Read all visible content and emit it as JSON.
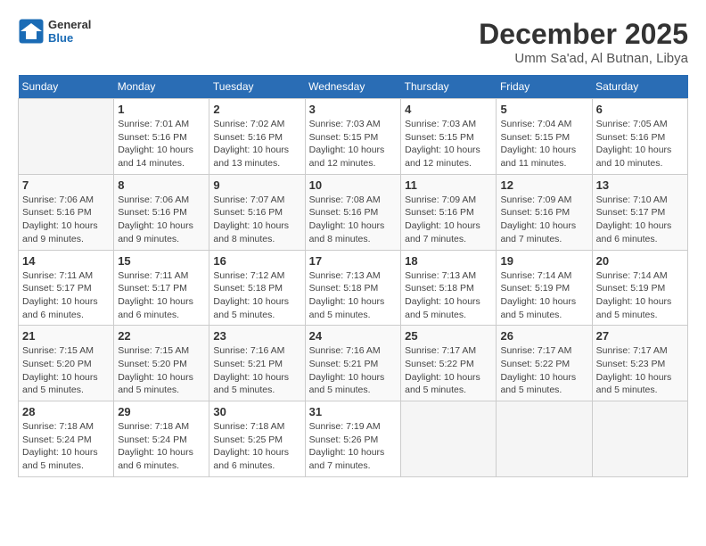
{
  "header": {
    "logo_general": "General",
    "logo_blue": "Blue",
    "title": "December 2025",
    "location": "Umm Sa'ad, Al Butnan, Libya"
  },
  "calendar": {
    "headers": [
      "Sunday",
      "Monday",
      "Tuesday",
      "Wednesday",
      "Thursday",
      "Friday",
      "Saturday"
    ],
    "weeks": [
      [
        {
          "day": "",
          "sunrise": "",
          "sunset": "",
          "daylight": ""
        },
        {
          "day": "1",
          "sunrise": "Sunrise: 7:01 AM",
          "sunset": "Sunset: 5:16 PM",
          "daylight": "Daylight: 10 hours and 14 minutes."
        },
        {
          "day": "2",
          "sunrise": "Sunrise: 7:02 AM",
          "sunset": "Sunset: 5:16 PM",
          "daylight": "Daylight: 10 hours and 13 minutes."
        },
        {
          "day": "3",
          "sunrise": "Sunrise: 7:03 AM",
          "sunset": "Sunset: 5:15 PM",
          "daylight": "Daylight: 10 hours and 12 minutes."
        },
        {
          "day": "4",
          "sunrise": "Sunrise: 7:03 AM",
          "sunset": "Sunset: 5:15 PM",
          "daylight": "Daylight: 10 hours and 12 minutes."
        },
        {
          "day": "5",
          "sunrise": "Sunrise: 7:04 AM",
          "sunset": "Sunset: 5:15 PM",
          "daylight": "Daylight: 10 hours and 11 minutes."
        },
        {
          "day": "6",
          "sunrise": "Sunrise: 7:05 AM",
          "sunset": "Sunset: 5:16 PM",
          "daylight": "Daylight: 10 hours and 10 minutes."
        }
      ],
      [
        {
          "day": "7",
          "sunrise": "Sunrise: 7:06 AM",
          "sunset": "Sunset: 5:16 PM",
          "daylight": "Daylight: 10 hours and 9 minutes."
        },
        {
          "day": "8",
          "sunrise": "Sunrise: 7:06 AM",
          "sunset": "Sunset: 5:16 PM",
          "daylight": "Daylight: 10 hours and 9 minutes."
        },
        {
          "day": "9",
          "sunrise": "Sunrise: 7:07 AM",
          "sunset": "Sunset: 5:16 PM",
          "daylight": "Daylight: 10 hours and 8 minutes."
        },
        {
          "day": "10",
          "sunrise": "Sunrise: 7:08 AM",
          "sunset": "Sunset: 5:16 PM",
          "daylight": "Daylight: 10 hours and 8 minutes."
        },
        {
          "day": "11",
          "sunrise": "Sunrise: 7:09 AM",
          "sunset": "Sunset: 5:16 PM",
          "daylight": "Daylight: 10 hours and 7 minutes."
        },
        {
          "day": "12",
          "sunrise": "Sunrise: 7:09 AM",
          "sunset": "Sunset: 5:16 PM",
          "daylight": "Daylight: 10 hours and 7 minutes."
        },
        {
          "day": "13",
          "sunrise": "Sunrise: 7:10 AM",
          "sunset": "Sunset: 5:17 PM",
          "daylight": "Daylight: 10 hours and 6 minutes."
        }
      ],
      [
        {
          "day": "14",
          "sunrise": "Sunrise: 7:11 AM",
          "sunset": "Sunset: 5:17 PM",
          "daylight": "Daylight: 10 hours and 6 minutes."
        },
        {
          "day": "15",
          "sunrise": "Sunrise: 7:11 AM",
          "sunset": "Sunset: 5:17 PM",
          "daylight": "Daylight: 10 hours and 6 minutes."
        },
        {
          "day": "16",
          "sunrise": "Sunrise: 7:12 AM",
          "sunset": "Sunset: 5:18 PM",
          "daylight": "Daylight: 10 hours and 5 minutes."
        },
        {
          "day": "17",
          "sunrise": "Sunrise: 7:13 AM",
          "sunset": "Sunset: 5:18 PM",
          "daylight": "Daylight: 10 hours and 5 minutes."
        },
        {
          "day": "18",
          "sunrise": "Sunrise: 7:13 AM",
          "sunset": "Sunset: 5:18 PM",
          "daylight": "Daylight: 10 hours and 5 minutes."
        },
        {
          "day": "19",
          "sunrise": "Sunrise: 7:14 AM",
          "sunset": "Sunset: 5:19 PM",
          "daylight": "Daylight: 10 hours and 5 minutes."
        },
        {
          "day": "20",
          "sunrise": "Sunrise: 7:14 AM",
          "sunset": "Sunset: 5:19 PM",
          "daylight": "Daylight: 10 hours and 5 minutes."
        }
      ],
      [
        {
          "day": "21",
          "sunrise": "Sunrise: 7:15 AM",
          "sunset": "Sunset: 5:20 PM",
          "daylight": "Daylight: 10 hours and 5 minutes."
        },
        {
          "day": "22",
          "sunrise": "Sunrise: 7:15 AM",
          "sunset": "Sunset: 5:20 PM",
          "daylight": "Daylight: 10 hours and 5 minutes."
        },
        {
          "day": "23",
          "sunrise": "Sunrise: 7:16 AM",
          "sunset": "Sunset: 5:21 PM",
          "daylight": "Daylight: 10 hours and 5 minutes."
        },
        {
          "day": "24",
          "sunrise": "Sunrise: 7:16 AM",
          "sunset": "Sunset: 5:21 PM",
          "daylight": "Daylight: 10 hours and 5 minutes."
        },
        {
          "day": "25",
          "sunrise": "Sunrise: 7:17 AM",
          "sunset": "Sunset: 5:22 PM",
          "daylight": "Daylight: 10 hours and 5 minutes."
        },
        {
          "day": "26",
          "sunrise": "Sunrise: 7:17 AM",
          "sunset": "Sunset: 5:22 PM",
          "daylight": "Daylight: 10 hours and 5 minutes."
        },
        {
          "day": "27",
          "sunrise": "Sunrise: 7:17 AM",
          "sunset": "Sunset: 5:23 PM",
          "daylight": "Daylight: 10 hours and 5 minutes."
        }
      ],
      [
        {
          "day": "28",
          "sunrise": "Sunrise: 7:18 AM",
          "sunset": "Sunset: 5:24 PM",
          "daylight": "Daylight: 10 hours and 5 minutes."
        },
        {
          "day": "29",
          "sunrise": "Sunrise: 7:18 AM",
          "sunset": "Sunset: 5:24 PM",
          "daylight": "Daylight: 10 hours and 6 minutes."
        },
        {
          "day": "30",
          "sunrise": "Sunrise: 7:18 AM",
          "sunset": "Sunset: 5:25 PM",
          "daylight": "Daylight: 10 hours and 6 minutes."
        },
        {
          "day": "31",
          "sunrise": "Sunrise: 7:19 AM",
          "sunset": "Sunset: 5:26 PM",
          "daylight": "Daylight: 10 hours and 7 minutes."
        },
        {
          "day": "",
          "sunrise": "",
          "sunset": "",
          "daylight": ""
        },
        {
          "day": "",
          "sunrise": "",
          "sunset": "",
          "daylight": ""
        },
        {
          "day": "",
          "sunrise": "",
          "sunset": "",
          "daylight": ""
        }
      ]
    ]
  }
}
